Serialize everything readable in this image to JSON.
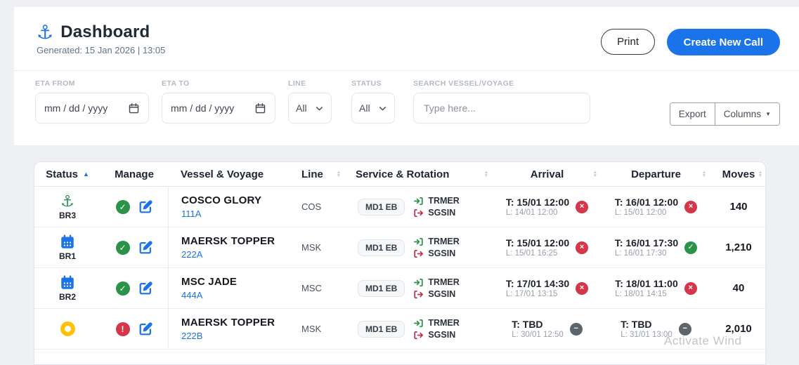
{
  "colors": {
    "accent": "#1a73e8",
    "green": "#2b9348",
    "red": "#d63649",
    "yellow": "#ffc107",
    "gray_badge": "#5c646c"
  },
  "header": {
    "title": "Dashboard",
    "subtitle": "Generated: 15 Jan 2026 | 13:05",
    "print_label": "Print",
    "create_label": "Create New Call"
  },
  "filters": {
    "eta_from_label": "ETA FROM",
    "eta_to_label": "ETA TO",
    "line_label": "LINE",
    "status_label": "STATUS",
    "search_label": "SEARCH VESSEL/VOYAGE",
    "date_placeholder": "mm / dd / yyyy",
    "line_value": "All",
    "status_value": "All",
    "search_placeholder": "Type here...",
    "export_label": "Export",
    "columns_label": "Columns"
  },
  "table": {
    "headers": [
      {
        "label": "Status",
        "sort": "asc"
      },
      {
        "label": "Manage",
        "sort": "none"
      },
      {
        "label": "Vessel & Voyage",
        "sort": "none"
      },
      {
        "label": "Line",
        "sort": "both"
      },
      {
        "label": "Service & Rotation",
        "sort": "both"
      },
      {
        "label": "Arrival",
        "sort": "both"
      },
      {
        "label": "Departure",
        "sort": "both"
      },
      {
        "label": "Moves",
        "sort": "both"
      }
    ],
    "rows": [
      {
        "status": {
          "icon": "anchor",
          "berth": "BR3"
        },
        "manage": {
          "state": "check"
        },
        "vessel": {
          "name": "COSCO GLORY",
          "voyage": "111A"
        },
        "line": "COS",
        "service": "MD1 EB",
        "rotation": {
          "in": "TRMER",
          "out": "SGSIN"
        },
        "arrival": {
          "target": "T: 15/01 12:00",
          "live": "L: 14/01 12:00",
          "badge": "x"
        },
        "departure": {
          "target": "T: 16/01 12:00",
          "live": "L: 15/01 12:00",
          "badge": "x"
        },
        "moves": "140"
      },
      {
        "status": {
          "icon": "calendar",
          "berth": "BR1"
        },
        "manage": {
          "state": "check"
        },
        "vessel": {
          "name": "MAERSK TOPPER",
          "voyage": "222A"
        },
        "line": "MSK",
        "service": "MD1 EB",
        "rotation": {
          "in": "TRMER",
          "out": "SGSIN"
        },
        "arrival": {
          "target": "T: 15/01 12:00",
          "live": "L: 15/01 16:25",
          "badge": "x"
        },
        "departure": {
          "target": "T: 16/01 17:30",
          "live": "L: 16/01 17:30",
          "badge": "check"
        },
        "moves": "1,210"
      },
      {
        "status": {
          "icon": "calendar",
          "berth": "BR2"
        },
        "manage": {
          "state": "check"
        },
        "vessel": {
          "name": "MSC JADE",
          "voyage": "444A"
        },
        "line": "MSC",
        "service": "MD1 EB",
        "rotation": {
          "in": "TRMER",
          "out": "SGSIN"
        },
        "arrival": {
          "target": "T: 17/01 14:30",
          "live": "L: 17/01 13:15",
          "badge": "x"
        },
        "departure": {
          "target": "T: 18/01 11:00",
          "live": "L: 18/01 14:15",
          "badge": "x"
        },
        "moves": "40"
      },
      {
        "status": {
          "icon": "ring",
          "berth": ""
        },
        "manage": {
          "state": "alert"
        },
        "vessel": {
          "name": "MAERSK TOPPER",
          "voyage": "222B"
        },
        "line": "MSK",
        "service": "MD1 EB",
        "rotation": {
          "in": "TRMER",
          "out": "SGSIN"
        },
        "arrival": {
          "target": "T: TBD",
          "live": "L: 30/01 12:50",
          "badge": "minus"
        },
        "departure": {
          "target": "T: TBD",
          "live": "L: 31/01 13:00",
          "badge": "minus"
        },
        "moves": "2,010"
      }
    ]
  },
  "watermark": "Activate Wind"
}
